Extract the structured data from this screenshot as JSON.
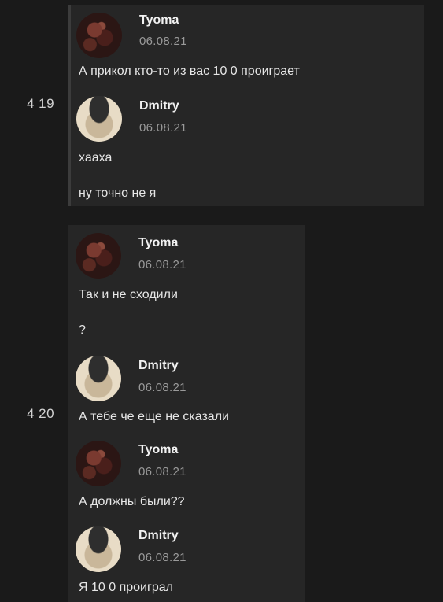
{
  "time_labels": [
    "4 19",
    "4 20"
  ],
  "panel1": {
    "messages": [
      {
        "author": "Tyoma",
        "date": "06.08.21",
        "avatar": "tyoma",
        "lines": [
          "А прикол кто-то из вас 10 0 проиграет"
        ]
      },
      {
        "author": "Dmitry",
        "date": "06.08.21",
        "avatar": "dmitry",
        "lines": [
          "хааха",
          "ну точно не я"
        ]
      }
    ]
  },
  "panel2": {
    "messages": [
      {
        "author": "Tyoma",
        "date": "06.08.21",
        "avatar": "tyoma",
        "lines": [
          "Так и не сходили",
          "?"
        ]
      },
      {
        "author": "Dmitry",
        "date": "06.08.21",
        "avatar": "dmitry",
        "lines": [
          "А тебе че еще не сказали"
        ]
      },
      {
        "author": "Tyoma",
        "date": "06.08.21",
        "avatar": "tyoma",
        "lines": [
          "А должны были??"
        ]
      },
      {
        "author": "Dmitry",
        "date": "06.08.21",
        "avatar": "dmitry",
        "lines": [
          "Я 10 0 проиграл"
        ]
      }
    ]
  }
}
